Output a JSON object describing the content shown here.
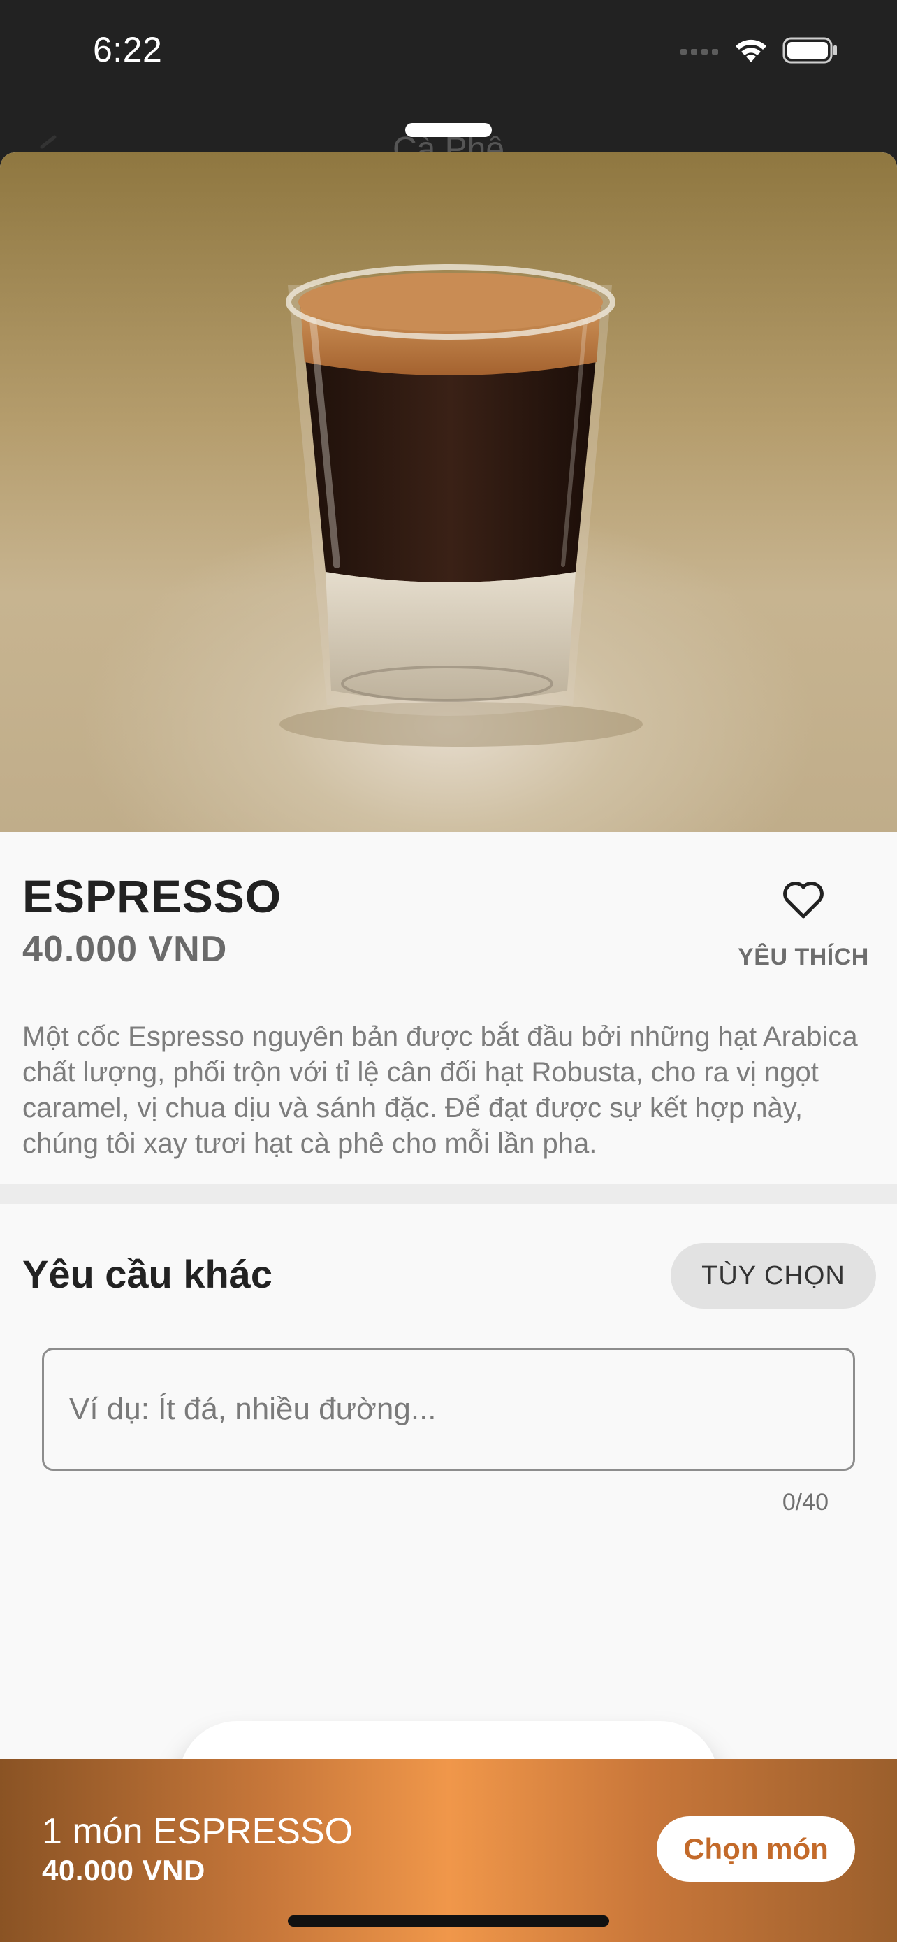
{
  "status_bar": {
    "time": "6:22"
  },
  "navigation": {
    "title_behind_sheet": "Cà Phê"
  },
  "product": {
    "name": "ESPRESSO",
    "price": "40.000 VND",
    "favorite_label": "YÊU THÍCH",
    "description": "Một cốc Espresso nguyên bản được bắt đầu bởi những hạt Arabica chất lượng, phối trộn với tỉ lệ cân đối hạt Robusta, cho ra vị ngọt caramel, vị chua dịu và sánh đặc. Để đạt được sự kết hợp này, chúng tôi xay tươi hạt cà phê cho mỗi lần pha."
  },
  "requests": {
    "title": "Yêu cầu khác",
    "options_button": "TÙY CHỌN",
    "note_placeholder": "Ví dụ: Ít đá, nhiều đường...",
    "char_counter": "0/40"
  },
  "quantity": {
    "value": "1"
  },
  "cart": {
    "summary": "1 món ESPRESSO",
    "total": "40.000 VND",
    "button_label": "Chọn món"
  },
  "colors": {
    "accent": "#c36a2a",
    "cart_gradient_center": "#f0974a",
    "sheet_background": "#f9f9f9"
  },
  "icons": [
    "wifi-icon",
    "battery-icon",
    "cellular-signal-icon",
    "back-chevron-icon",
    "heart-icon",
    "minus-icon",
    "plus-icon"
  ]
}
